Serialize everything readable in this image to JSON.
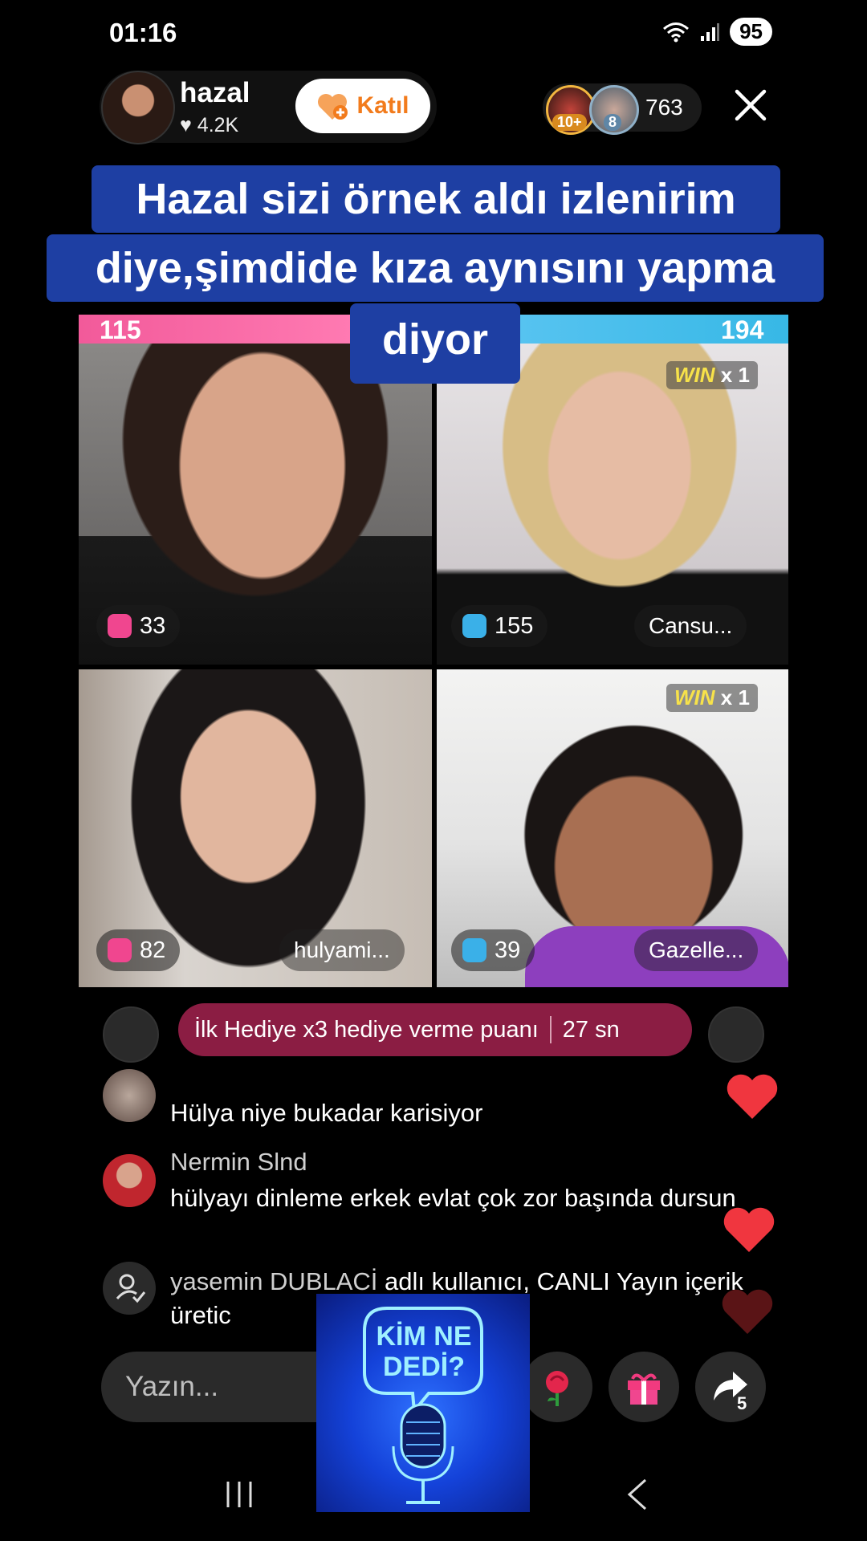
{
  "status": {
    "time": "01:16",
    "battery": "95"
  },
  "host": {
    "name": "hazal",
    "likes": "4.2K",
    "join_label": "Katıl"
  },
  "viewers": {
    "count": "763",
    "badge1": "10+",
    "badge2": "8"
  },
  "caption": {
    "line1": "Hazal sizi örnek aldı izlenirim",
    "line2": "diye,şimdide kıza aynısını yapma",
    "line3": "diyor"
  },
  "battle": {
    "left_score": "115",
    "right_score": "194"
  },
  "tiles": [
    {
      "gift_count": "33",
      "name": "",
      "win": false
    },
    {
      "gift_count": "155",
      "name": "Cansu...",
      "win": true,
      "win_word": "WIN",
      "win_mult": "x 1"
    },
    {
      "gift_count": "82",
      "name": "hulyami...",
      "win": false
    },
    {
      "gift_count": "39",
      "name": "Gazelle...",
      "win": true,
      "win_word": "WIN",
      "win_mult": "x 1"
    }
  ],
  "gift_bar": {
    "text": "İlk Hediye x3 hediye verme puanı",
    "timer": "27 sn"
  },
  "chat": [
    {
      "name": "",
      "text": "Hülya niye bukadar karisiyor"
    },
    {
      "name": "Nermin Slnd",
      "text": "hülyayı dinleme erkek evlat çok zor başında dursun"
    },
    {
      "name": "yasemin DUBLACİ",
      "text": " adlı kullanıcı, CANLI Yayın içerik üretic"
    }
  ],
  "input": {
    "placeholder": "Yazın..."
  },
  "share": {
    "count": "5"
  },
  "logo": {
    "line1": "KİM NE",
    "line2": "DEDİ?"
  },
  "colors": {
    "caption_bg": "#1e3fa3",
    "battle_left": "#f25a9a",
    "battle_right": "#37b8e6",
    "gift_bar": "#8b1d43",
    "join_text": "#f27b1c"
  }
}
